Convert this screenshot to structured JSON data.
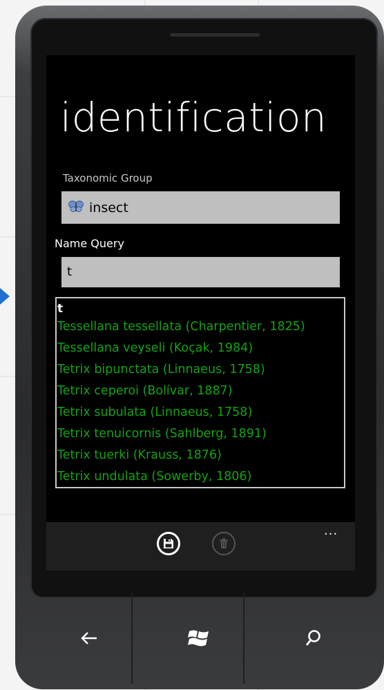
{
  "page": {
    "title": "identification"
  },
  "taxonomic_group": {
    "label": "Taxonomic Group",
    "value": "insect",
    "icon": "butterfly-icon"
  },
  "name_query": {
    "label": "Name Query",
    "value": "t"
  },
  "results": {
    "header": "t",
    "items": [
      "Tessellana tessellata (Charpentier, 1825)",
      "Tessellana veyseli (Koçak, 1984)",
      "Tetrix bipunctata (Linnaeus, 1758)",
      "Tetrix ceperoi (Bolívar, 1887)",
      "Tetrix subulata (Linnaeus, 1758)",
      "Tetrix tenuicornis (Sahlberg, 1891)",
      "Tetrix tuerki (Krauss, 1876)",
      "Tetrix undulata (Sowerby, 1806)"
    ]
  },
  "app_bar": {
    "more_label": "..."
  },
  "colors": {
    "accent_green": "#13a313",
    "input_bg": "#bfbfbf",
    "screen_bg": "#000000",
    "pointer_blue": "#1f6fd0"
  }
}
